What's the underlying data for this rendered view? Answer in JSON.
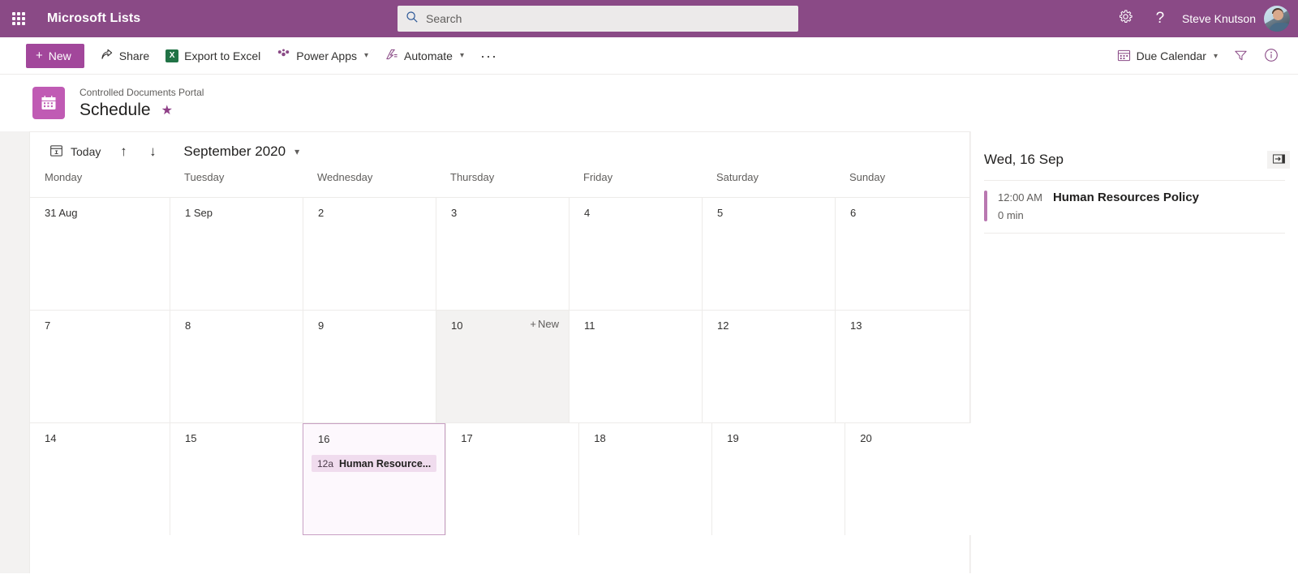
{
  "suite": {
    "waffle_label": "app-launcher",
    "brand": "Microsoft Lists",
    "search_placeholder": "Search",
    "search_value": "",
    "settings_label": "Settings",
    "help_label": "Help",
    "user_name": "Steve Knutson"
  },
  "command_bar": {
    "new_label": "New",
    "items": [
      {
        "label": "Share",
        "icon": "share-icon",
        "caret": false
      },
      {
        "label": "Export to Excel",
        "icon": "excel-icon",
        "caret": false
      },
      {
        "label": "Power Apps",
        "icon": "power-apps-icon",
        "caret": true
      },
      {
        "label": "Automate",
        "icon": "automate-icon",
        "caret": true
      }
    ],
    "overflow_label": "···",
    "view_label": "Due Calendar",
    "filter_label": "Filter",
    "info_label": "Information"
  },
  "page": {
    "breadcrumb": "Controlled Documents Portal",
    "title": "Schedule",
    "favorite_icon": "★"
  },
  "calendar": {
    "today_label": "Today",
    "prev_label": "↑",
    "next_label": "↓",
    "month_label": "September 2020",
    "weekdays": [
      "Monday",
      "Tuesday",
      "Wednesday",
      "Thursday",
      "Friday",
      "Saturday",
      "Sunday"
    ],
    "new_cell_label": "New",
    "weeks": [
      [
        {
          "num": "31 Aug",
          "state": "normal",
          "events": []
        },
        {
          "num": "1 Sep",
          "state": "normal",
          "events": []
        },
        {
          "num": "2",
          "state": "normal",
          "events": []
        },
        {
          "num": "3",
          "state": "normal",
          "events": []
        },
        {
          "num": "4",
          "state": "normal",
          "events": []
        },
        {
          "num": "5",
          "state": "normal",
          "events": []
        },
        {
          "num": "6",
          "state": "normal",
          "events": []
        }
      ],
      [
        {
          "num": "7",
          "state": "normal",
          "events": []
        },
        {
          "num": "8",
          "state": "normal",
          "events": []
        },
        {
          "num": "9",
          "state": "normal",
          "events": []
        },
        {
          "num": "10",
          "state": "hovered",
          "events": []
        },
        {
          "num": "11",
          "state": "normal",
          "events": []
        },
        {
          "num": "12",
          "state": "normal",
          "events": []
        },
        {
          "num": "13",
          "state": "normal",
          "events": []
        }
      ],
      [
        {
          "num": "14",
          "state": "normal",
          "events": []
        },
        {
          "num": "15",
          "state": "normal",
          "events": []
        },
        {
          "num": "16",
          "state": "selected",
          "events": [
            {
              "time": "12a",
              "title": "Human Resource..."
            }
          ]
        },
        {
          "num": "17",
          "state": "normal",
          "events": []
        },
        {
          "num": "18",
          "state": "normal",
          "events": []
        },
        {
          "num": "19",
          "state": "normal",
          "events": []
        },
        {
          "num": "20",
          "state": "normal",
          "events": []
        }
      ]
    ]
  },
  "detail_panel": {
    "date_header": "Wed, 16 Sep",
    "collapse_icon": "collapse-panel-icon",
    "events": [
      {
        "time": "12:00 AM",
        "title": "Human Resources Policy",
        "duration": "0 min"
      }
    ]
  },
  "colors": {
    "suite_header": "#8a4a86",
    "accent": "#a2479b",
    "list_icon": "#c05bb4",
    "event_chip": "#f0dcee",
    "selected_cell_border": "#c8a0c4",
    "panel_bar": "#b978b1"
  }
}
